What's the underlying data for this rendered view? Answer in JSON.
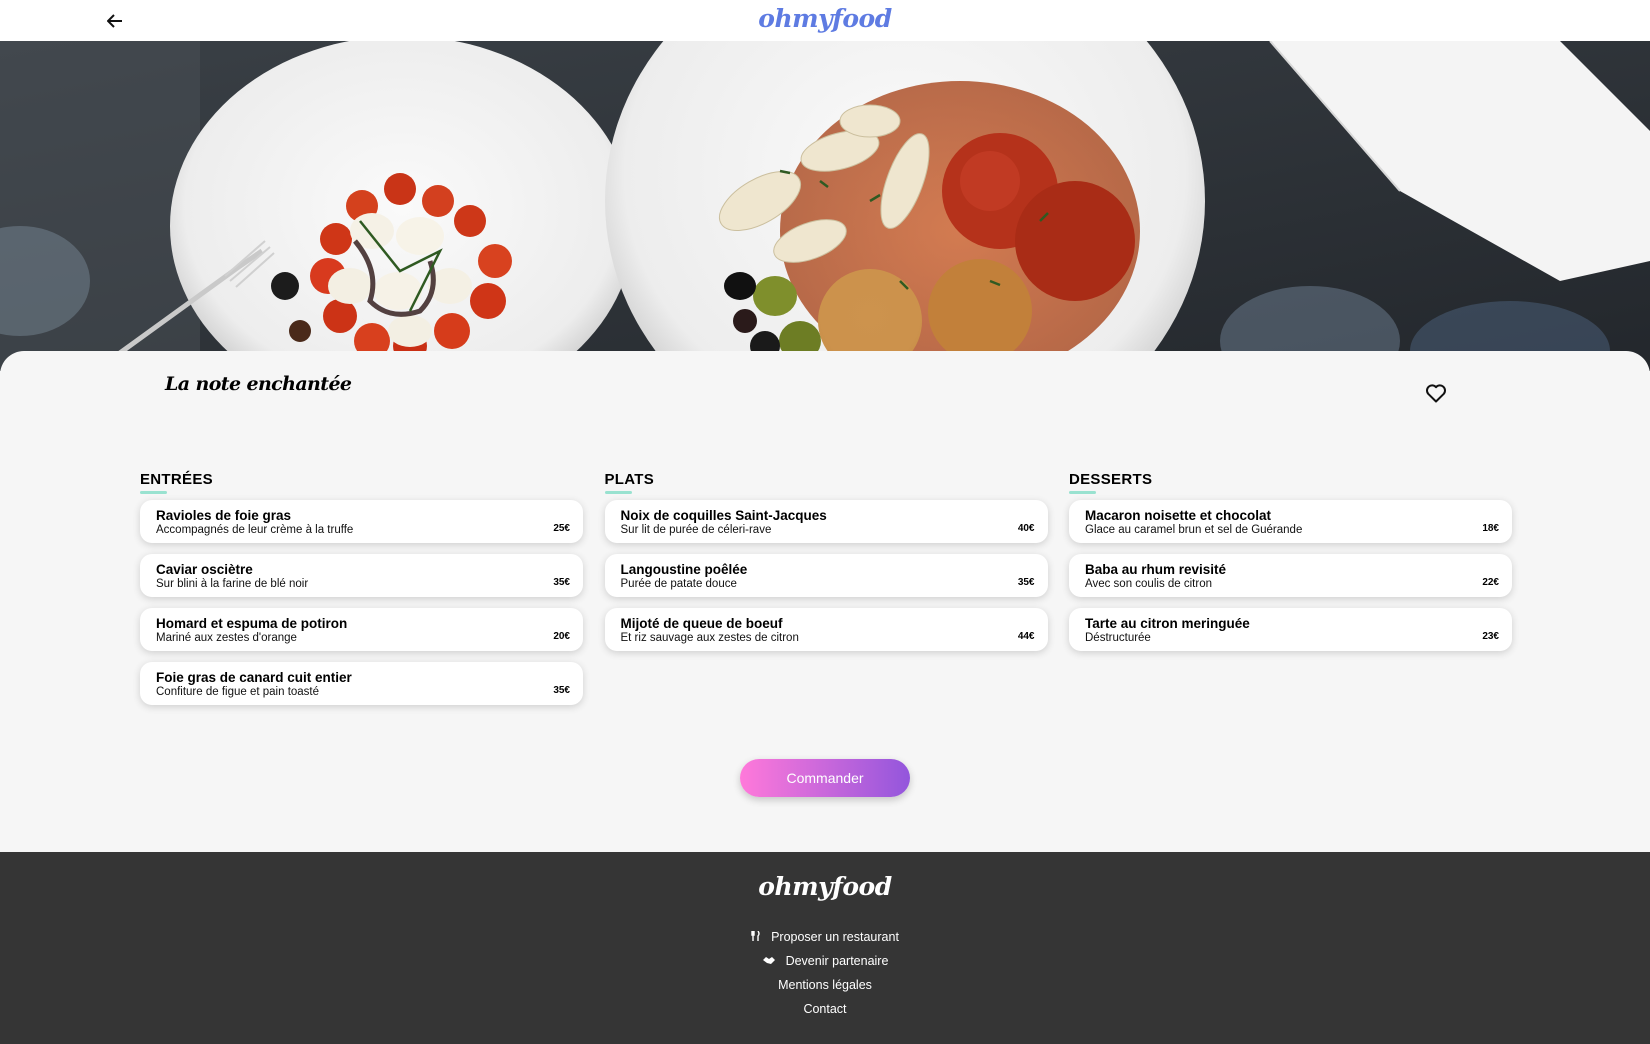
{
  "header": {
    "logo": "ohmyfood",
    "back_icon": "arrow-left-icon"
  },
  "restaurant": {
    "name": "La note enchantée",
    "favorite_icon": "heart-outline-icon"
  },
  "menu": {
    "entrees": {
      "title": "ENTRÉES",
      "items": [
        {
          "name": "Ravioles de foie gras",
          "desc": "Accompagnés de leur crème à la truffe",
          "price": "25€"
        },
        {
          "name": "Caviar osciètre",
          "desc": "Sur blini à la farine de blé noir",
          "price": "35€"
        },
        {
          "name": "Homard et espuma de potiron",
          "desc": "Mariné aux zestes d'orange",
          "price": "20€"
        },
        {
          "name": "Foie gras de canard cuit entier",
          "desc": "Confiture de figue et pain toasté",
          "price": "35€"
        }
      ]
    },
    "plats": {
      "title": "PLATS",
      "items": [
        {
          "name": "Noix de coquilles Saint-Jacques",
          "desc": "Sur lit de purée de céleri-rave",
          "price": "40€"
        },
        {
          "name": "Langoustine poêlée",
          "desc": "Purée de patate douce",
          "price": "35€"
        },
        {
          "name": "Mijoté de queue de boeuf",
          "desc": "Et riz sauvage aux zestes de citron",
          "price": "44€"
        }
      ]
    },
    "desserts": {
      "title": "DESSERTS",
      "items": [
        {
          "name": "Macaron noisette et chocolat",
          "desc": "Glace au caramel brun et sel de Guérande",
          "price": "18€"
        },
        {
          "name": "Baba au rhum revisité",
          "desc": "Avec son coulis de citron",
          "price": "22€"
        },
        {
          "name": "Tarte au citron meringuée",
          "desc": "Déstructurée",
          "price": "23€"
        }
      ]
    }
  },
  "order_button": "Commander",
  "footer": {
    "logo": "ohmyfood",
    "links": [
      {
        "label": "Proposer un restaurant",
        "icon": "utensils-icon"
      },
      {
        "label": "Devenir partenaire",
        "icon": "handshake-icon"
      },
      {
        "label": "Mentions légales"
      },
      {
        "label": "Contact"
      }
    ]
  },
  "colors": {
    "brand": "#5e7be2",
    "accent_underline": "#99e2d0",
    "button_gradient_start": "#ff79da",
    "button_gradient_end": "#9356dc",
    "footer_bg": "#353535"
  }
}
